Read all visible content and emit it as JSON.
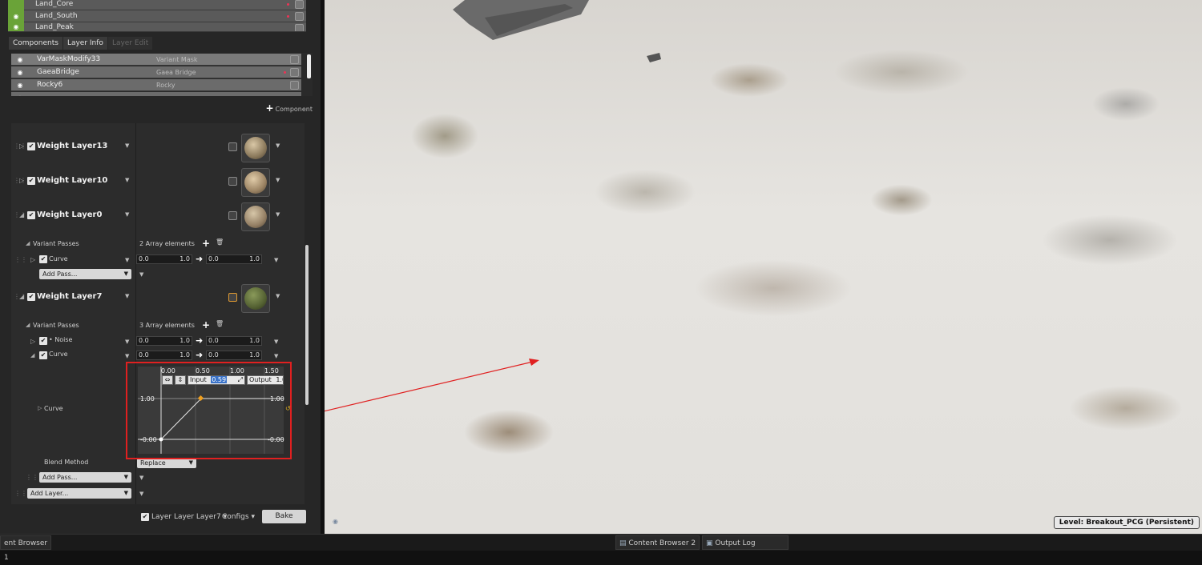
{
  "top_layers": [
    {
      "name": "Land_Core"
    },
    {
      "name": "Land_South"
    },
    {
      "name": "Land_Peak"
    }
  ],
  "tabs": [
    "Components",
    "Layer Info",
    "Layer Edit"
  ],
  "components": [
    {
      "name": "VarMaskModify33",
      "type": "Variant Mask"
    },
    {
      "name": "GaeaBridge",
      "type": "Gaea Bridge"
    },
    {
      "name": "Rocky6",
      "type": "Rocky"
    }
  ],
  "add_component_label": "Component",
  "weight_layers": [
    {
      "name": "Weight Layer13"
    },
    {
      "name": "Weight Layer10"
    },
    {
      "name": "Weight Layer0"
    },
    {
      "name": "Weight Layer7"
    }
  ],
  "variant_passes_label": "Variant Passes",
  "layer0_array": "2 Array elements",
  "layer7_array": "3 Array elements",
  "curve_label": "Curve",
  "noise_label": "Noise",
  "range": {
    "a": "0.0",
    "b": "1.0",
    "c": "0.0",
    "d": "1.0"
  },
  "add_pass_label": "Add Pass...",
  "curve_editor": {
    "ticks_x": [
      "0.00",
      "0.50",
      "1.00",
      "1.50"
    ],
    "y_top": "1.00",
    "y_bottom": "-0.00",
    "input_label": "Input",
    "input_value": "0.59",
    "output_label": "Output",
    "output_value": "1.0"
  },
  "blend_method_label": "Blend Method",
  "blend_method_value": "Replace",
  "add_layer_label": "Add Layer...",
  "footer": {
    "layer_check_label": "Layer Layer Layer7",
    "configs_label": "Configs",
    "bake_label": "Bake"
  },
  "level_label": "Level:",
  "level_value": "Breakout_PCG (Persistent)",
  "bottom_tabs": [
    "ent Browser 1",
    "Content Browser 2",
    "Output Log"
  ],
  "colors": {
    "annotation": "#e02020",
    "visible_green": "#6aa338",
    "key_point": "#f0a020"
  }
}
